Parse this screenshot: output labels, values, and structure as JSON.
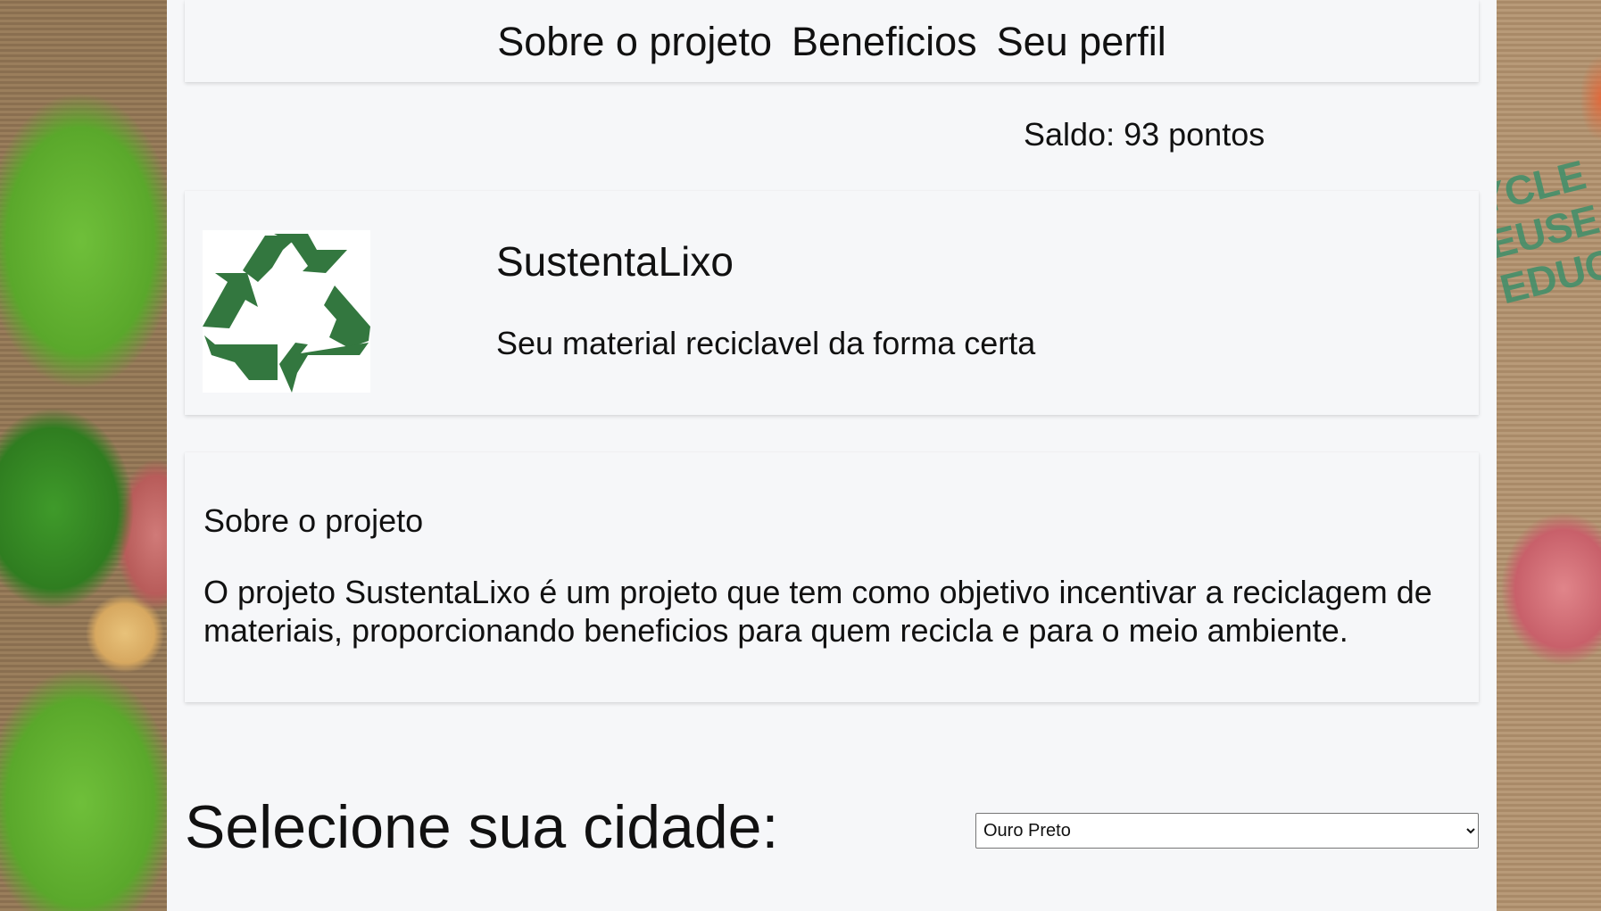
{
  "nav": {
    "items": [
      {
        "label": "Sobre o projeto"
      },
      {
        "label": "Beneficios"
      },
      {
        "label": "Seu perfil"
      }
    ]
  },
  "balance": {
    "text": "Saldo: 93 pontos"
  },
  "hero": {
    "logo_icon": "recycle-icon",
    "brand": "SustentaLixo",
    "tagline": "Seu material reciclavel da forma certa"
  },
  "about": {
    "title": "Sobre o projeto",
    "text": "O projeto SustentaLixo é um projeto que tem como objetivo incentivar a reciclagem de materiais, proporcionando beneficios para quem recicla e para o meio ambiente."
  },
  "city": {
    "label": "Selecione sua cidade:",
    "selected": "Ouro Preto"
  },
  "background_stamp": {
    "lines": [
      "YCLE",
      "EUSE",
      "EDUC"
    ]
  },
  "colors": {
    "recycle_green": "#33773f",
    "page_bg": "#f6f7f9"
  }
}
